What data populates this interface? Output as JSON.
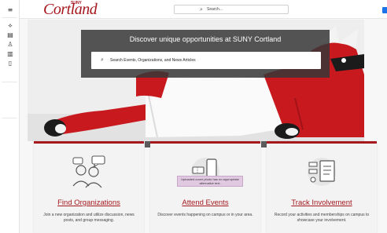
{
  "header": {
    "logo_text": "Cortland",
    "logo_suny": "SUNY",
    "search_placeholder": "Search..."
  },
  "hero": {
    "headline": "Discover unique opportunities at SUNY Cortland",
    "search_placeholder": "Search Events, Organizations, and News Articles"
  },
  "cards": [
    {
      "title": "Find Organizations",
      "description": "Join a new organization and utilize discussion, news posts, and group messaging.",
      "icon": "people-chat-icon"
    },
    {
      "title": "Attend Events",
      "description": "Discover events happening on campus or in your area.",
      "icon": "event-ticket-phone-icon",
      "tooltip": "Uploaded cover photo has no appropriate alternative text."
    },
    {
      "title": "Track Involvement",
      "description": "Record your activities and memberships on campus to showcase your involvement.",
      "icon": "clipboard-involvement-icon"
    }
  ],
  "colors": {
    "brand": "#a5181e",
    "overlay": "#373737"
  }
}
